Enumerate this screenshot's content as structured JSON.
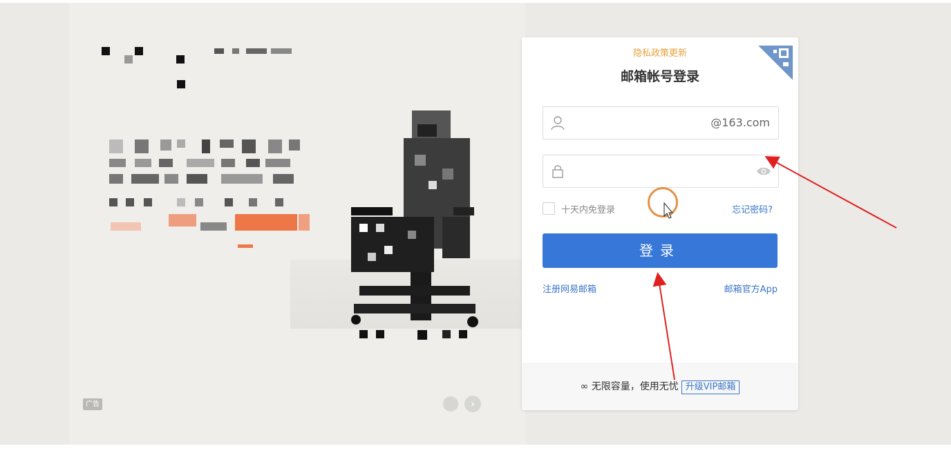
{
  "ad": {
    "tag": "广告"
  },
  "login": {
    "privacy_link": "隐私政策更新",
    "title": "邮箱帐号登录",
    "username": {
      "value": "",
      "suffix": "@163.com"
    },
    "password": {
      "value": ""
    },
    "remember_label": "十天内免登录",
    "forgot_label": "忘记密码?",
    "submit_label": "登录",
    "register_label": "注册网易邮箱",
    "app_label": "邮箱官方App",
    "footer_text": "∞ 无限容量，使用无忧",
    "vip_label": "升级VIP邮箱"
  },
  "colors": {
    "accent": "#3677d8",
    "link": "#3b75c9",
    "privacy": "#e6a23c",
    "annotation_arrow": "#e02020",
    "cursor_ring": "#e39145"
  },
  "icons": [
    "qr-code-icon",
    "user-icon",
    "lock-icon",
    "eye-icon",
    "chevron-right-icon",
    "mouse-cursor-icon"
  ]
}
